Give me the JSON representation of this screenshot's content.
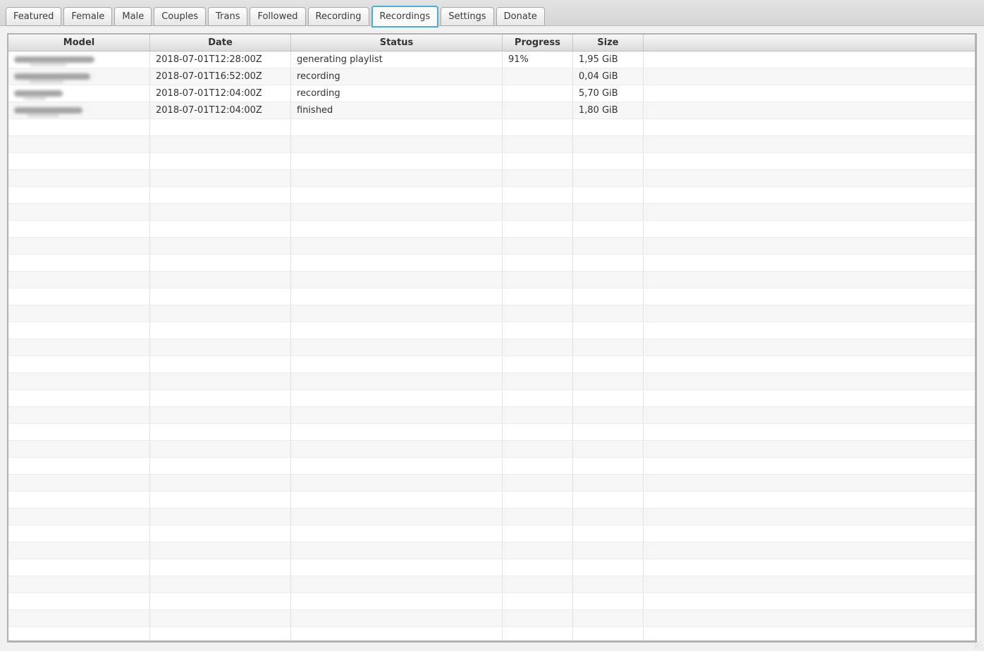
{
  "tabs": {
    "items": [
      {
        "label": "Featured",
        "active": false
      },
      {
        "label": "Female",
        "active": false
      },
      {
        "label": "Male",
        "active": false
      },
      {
        "label": "Couples",
        "active": false
      },
      {
        "label": "Trans",
        "active": false
      },
      {
        "label": "Followed",
        "active": false
      },
      {
        "label": "Recording",
        "active": false
      },
      {
        "label": "Recordings",
        "active": true
      },
      {
        "label": "Settings",
        "active": false
      },
      {
        "label": "Donate",
        "active": false
      }
    ]
  },
  "table": {
    "columns": [
      "Model",
      "Date",
      "Status",
      "Progress",
      "Size",
      ""
    ],
    "rows": [
      {
        "model": "",
        "redacted": true,
        "redacted_width": 114,
        "date": "2018-07-01T12:28:00Z",
        "status": "generating playlist",
        "progress": "91%",
        "size": "1,95 GiB"
      },
      {
        "model": "",
        "redacted": true,
        "redacted_width": 108,
        "date": "2018-07-01T16:52:00Z",
        "status": "recording",
        "progress": "",
        "size": "0,04 GiB"
      },
      {
        "model": "",
        "redacted": true,
        "redacted_width": 69,
        "date": "2018-07-01T12:04:00Z",
        "status": "recording",
        "progress": "",
        "size": "5,70 GiB"
      },
      {
        "model": "",
        "redacted": true,
        "redacted_width": 97,
        "date": "2018-07-01T12:04:00Z",
        "status": "finished",
        "progress": "",
        "size": "1,80 GiB"
      }
    ],
    "empty_row_count": 31
  },
  "colors": {
    "active_tab_border": "#47aede",
    "stripe": "#f6f6f6",
    "header_text": "#333333",
    "page_background": "#f1f1f1"
  }
}
